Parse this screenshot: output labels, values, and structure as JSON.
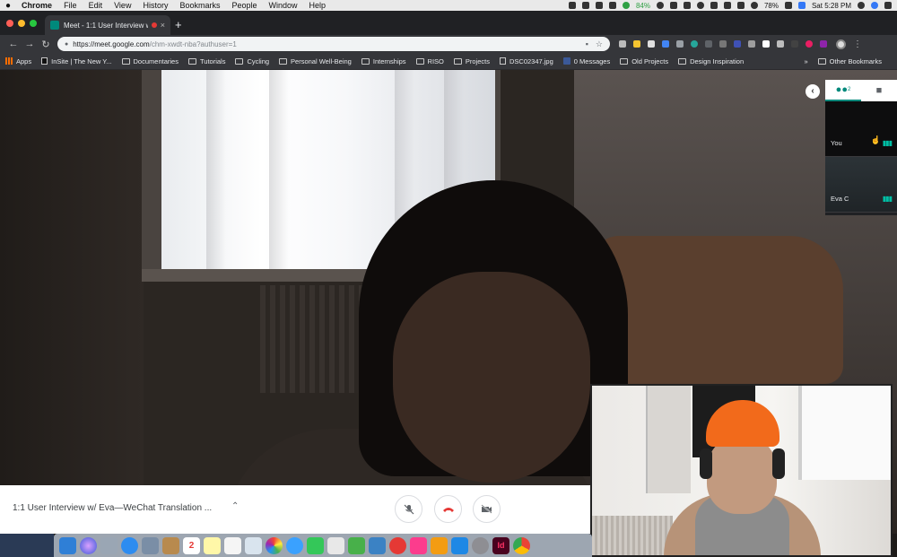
{
  "menubar": {
    "apple": "",
    "app": "Chrome",
    "items": [
      "File",
      "Edit",
      "View",
      "History",
      "Bookmarks",
      "People",
      "Window",
      "Help"
    ],
    "battery_app": "84%",
    "battery": "78%",
    "clock": "Sat 5:28 PM"
  },
  "tab": {
    "title": "Meet - 1:1 User Interview w",
    "close": "×",
    "new_tab": "+"
  },
  "toolbar": {
    "back": "←",
    "forward": "→",
    "reload": "↻",
    "url_host": "https://meet.google.com",
    "url_path": "/chm-xwdt-nba?authuser=1",
    "star": "☆",
    "kebab": "⋮"
  },
  "bookmarks": {
    "apps": "Apps",
    "items": [
      "InSite | The New Y...",
      "Documentaries",
      "Tutorials",
      "Cycling",
      "Personal Well-Being",
      "Internships",
      "RISO",
      "Projects",
      "DSC02347.jpg",
      "0 Messages",
      "Old Projects",
      "Design Inspiration"
    ],
    "more": "»",
    "other": "Other Bookmarks"
  },
  "panel": {
    "people_icon": "people-icon",
    "people_count": "2",
    "chat_icon": "chat-icon",
    "you_label": "You",
    "eva_label": "Eva C",
    "collapse": "‹"
  },
  "meetbar": {
    "title": "1:1 User Interview w/ Eva—WeChat Translation ...",
    "caret": "⌃",
    "mic_icon": "mic-off-icon",
    "hangup_icon": "hang-up-icon",
    "camera_icon": "camera-off-icon"
  },
  "colors": {
    "meet_teal": "#00897b",
    "hangup_red": "#e53935",
    "beanie_orange": "#f26a1b"
  },
  "dock": {
    "calendar_day": "2",
    "indesign": "Id"
  }
}
